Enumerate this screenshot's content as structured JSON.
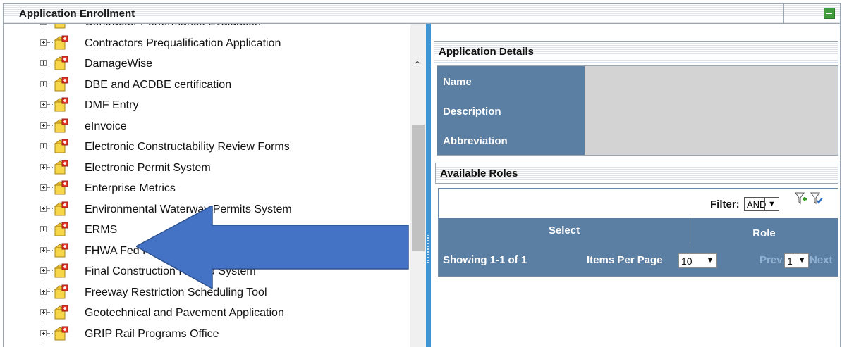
{
  "panel": {
    "title": "Application Enrollment"
  },
  "tree": {
    "items": [
      "Contractor Performance Evaluation",
      "Contractors Prequalification Application",
      "DamageWise",
      "DBE and ACDBE certification",
      "DMF Entry",
      "eInvoice",
      "Electronic Constructability Review Forms",
      "Electronic Permit System",
      "Enterprise Metrics",
      "Environmental Waterway Permits System",
      "ERMS",
      "FHWA Fed Highway Construction 1391 Report",
      "Final Construction Record System",
      "Freeway Restriction Scheduling Tool",
      "Geotechnical and Pavement Application",
      "GRIP Rail Programs Office"
    ]
  },
  "details": {
    "title": "Application Details",
    "name_label": "Name",
    "description_label": "Description",
    "abbreviation_label": "Abbreviation"
  },
  "roles": {
    "title": "Available Roles",
    "filter_label": "Filter:",
    "filter_value": "AND",
    "col_select": "Select",
    "col_role": "Role",
    "showing": "Showing 1-1 of 1",
    "items_per_page_label": "Items Per Page",
    "items_per_page_value": "10",
    "prev_label": "Prev",
    "page_value": "1",
    "next_label": "Next"
  },
  "colors": {
    "header_blue": "#5b7ea3",
    "splitter_blue": "#3f96d6",
    "annotation_arrow": "#4472c4"
  }
}
